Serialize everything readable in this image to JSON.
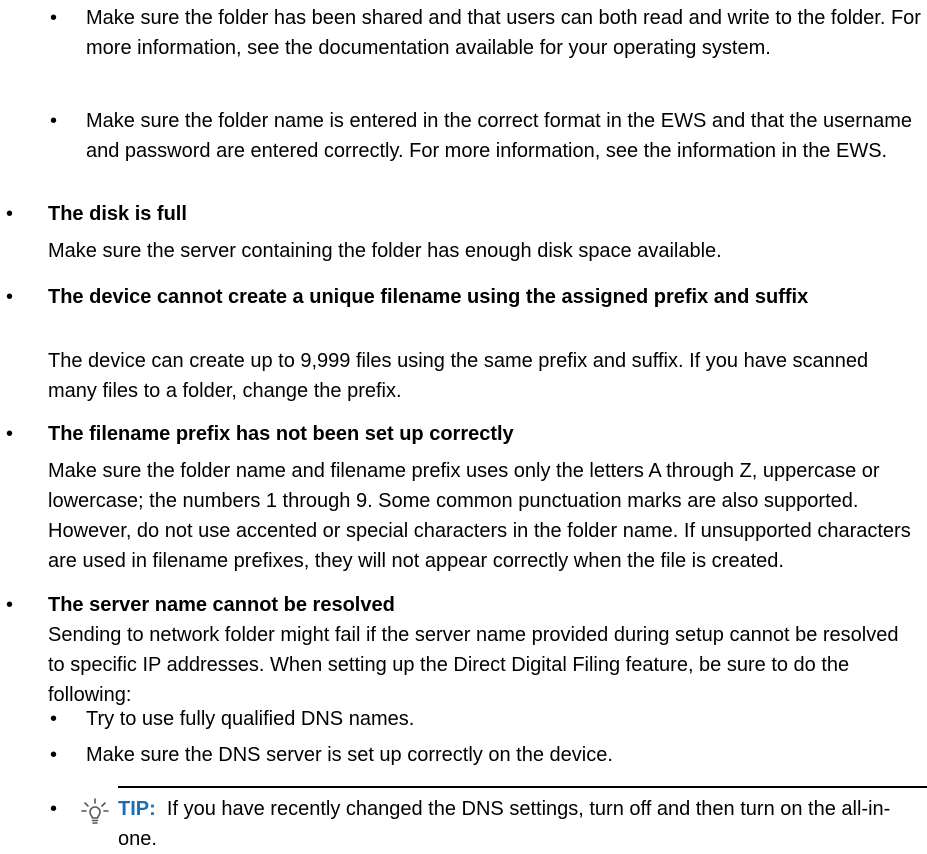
{
  "bullet_glyph": "•",
  "sub_items_top": [
    "Make sure the folder has been shared and that users can both read and write to the folder. For more information, see the documentation available for your operating system.",
    "Make sure the folder name is entered in the correct format in the EWS and that the username and password are entered correctly. For more information, see the information in the EWS."
  ],
  "items": [
    {
      "title": "The disk is full",
      "body": "Make sure the server containing the folder has enough disk space available."
    },
    {
      "title": "The device cannot create a unique filename using the assigned prefix and suffix",
      "body": "The device can create up to 9,999 files using the same prefix and suffix. If you have scanned many files to a folder, change the prefix."
    },
    {
      "title": "The filename prefix has not been set up correctly",
      "body": "Make sure the folder name and filename prefix uses only the letters A through Z, uppercase or lowercase; the numbers 1 through 9. Some common punctuation marks are also supported. However, do not use accented or special characters in the folder name. If unsupported characters are used in filename prefixes, they will not appear correctly when the file is created."
    },
    {
      "title": "The server name cannot be resolved",
      "body": "Sending to network folder might fail if the server name provided during setup cannot be resolved to specific IP addresses. When setting up the Direct Digital Filing feature, be sure to do the following:"
    }
  ],
  "sub_items_bottom": [
    "Try to use fully qualified DNS names.",
    "Make sure the DNS server is set up correctly on the device."
  ],
  "tip": {
    "icon": "lightbulb-icon",
    "label": "TIP:",
    "text": "If you have recently changed the DNS settings, turn off and then turn on the all-in-one.",
    "label_color": "#1a6fb5"
  }
}
